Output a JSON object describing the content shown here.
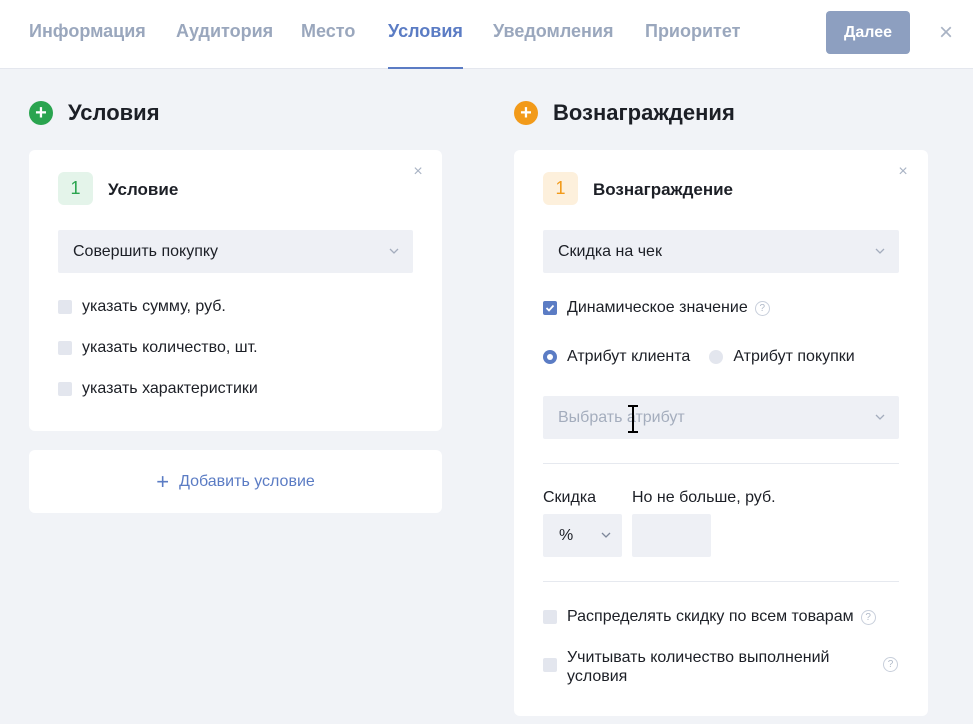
{
  "tabs": [
    {
      "label": "Информация"
    },
    {
      "label": "Аудитория"
    },
    {
      "label": "Место"
    },
    {
      "label": "Условия"
    },
    {
      "label": "Уведомления"
    },
    {
      "label": "Приоритет"
    }
  ],
  "active_tab": "Условия",
  "header": {
    "next_label": "Далее",
    "close_glyph": "×"
  },
  "conditions": {
    "title": "Условия",
    "plus_glyph": "+",
    "accent_color": "#2aa44f",
    "card": {
      "number": "1",
      "title": "Условие",
      "select_value": "Совершить покупку",
      "close_glyph": "×",
      "options": [
        {
          "label": "указать сумму, руб."
        },
        {
          "label": "указать количество, шт."
        },
        {
          "label": "указать характеристики"
        }
      ]
    },
    "add_label": "Добавить условие",
    "add_glyph": "+"
  },
  "rewards": {
    "title": "Вознаграждения",
    "plus_glyph": "+",
    "accent_color": "#f29a1a",
    "card": {
      "number": "1",
      "title": "Вознаграждение",
      "close_glyph": "×",
      "select_value": "Скидка на чек",
      "dynamic_label": "Динамическое значение",
      "dynamic_checked": true,
      "help_glyph": "?",
      "radio_client": "Атрибут клиента",
      "radio_purchase": "Атрибут покупки",
      "radio_selected": "client",
      "attribute_placeholder": "Выбрать атрибут",
      "discount_label": "Скидка",
      "discount_unit": "%",
      "max_label": "Но не больше, руб.",
      "max_value": "",
      "distribute_label": "Распределять скидку по всем товарам",
      "count_label_line1": "Учитывать количество выполнений",
      "count_label_line2": "условия"
    }
  }
}
